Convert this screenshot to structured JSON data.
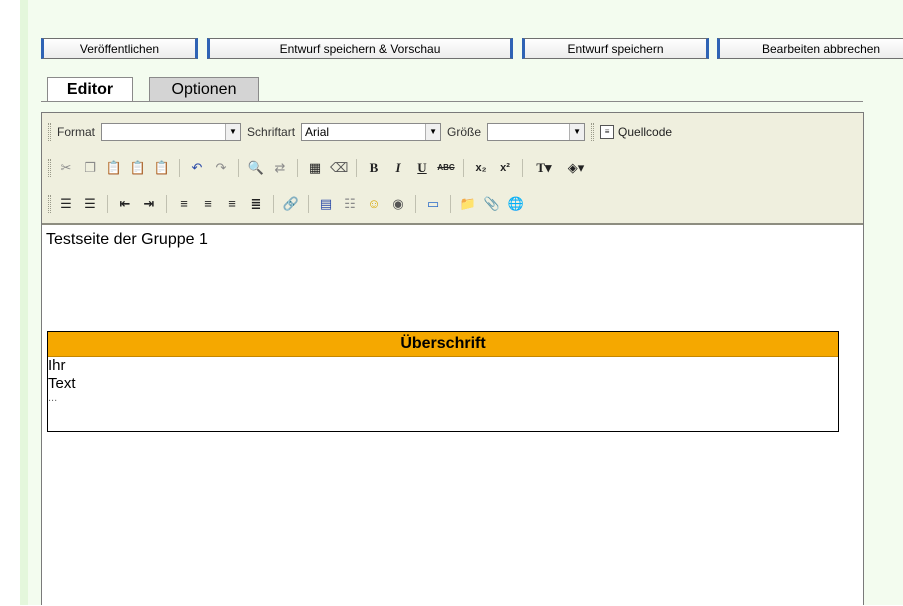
{
  "actions": {
    "publish": "Veröffentlichen",
    "save_preview": "Entwurf speichern & Vorschau",
    "save_draft": "Entwurf speichern",
    "cancel_edit": "Bearbeiten abbrechen"
  },
  "tabs": {
    "editor": "Editor",
    "options": "Optionen"
  },
  "toolbar": {
    "format_label": "Format",
    "format_value": "",
    "font_label": "Schriftart",
    "font_value": "Arial",
    "size_label": "Größe",
    "size_value": "",
    "source_label": "Quellcode"
  },
  "content": {
    "intro": "Testseite der Gruppe 1",
    "table_heading": "Überschrift",
    "lines": [
      "Ihr",
      "Text",
      "..."
    ]
  },
  "colors": {
    "heading_bg": "#f5a800",
    "button_border": "#2f63b5",
    "toolbar_bg": "#efefde"
  }
}
